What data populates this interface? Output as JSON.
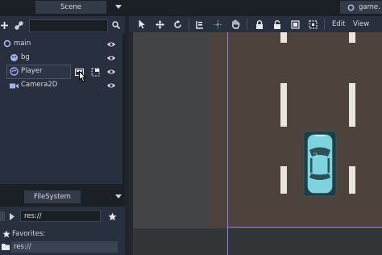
{
  "scene_panel": {
    "tab_label": "Scene",
    "filter_placeholder": "",
    "tree": [
      {
        "label": "main",
        "icon": "node-circle-icon",
        "visible": true
      },
      {
        "label": "bg",
        "icon": "sprite-icon",
        "visible": true
      },
      {
        "label": "Player",
        "icon": "kinematic-body-icon",
        "visible": true,
        "selected": true
      },
      {
        "label": "Camera2D",
        "icon": "camera-icon",
        "visible": true
      }
    ]
  },
  "filesystem_panel": {
    "tab_label": "FileSystem",
    "path_value": "res://",
    "favorites_label": "Favorites:",
    "tree_item": "res://"
  },
  "viewport": {
    "script_tab_label": "game.",
    "menu": {
      "edit": "Edit",
      "view": "View"
    }
  },
  "colors": {
    "road": "#4e433c",
    "grass": "#424446",
    "car": "#7fd3de",
    "lane_marking": "#e9e5da",
    "viewport_border": "#8c7cf0"
  }
}
